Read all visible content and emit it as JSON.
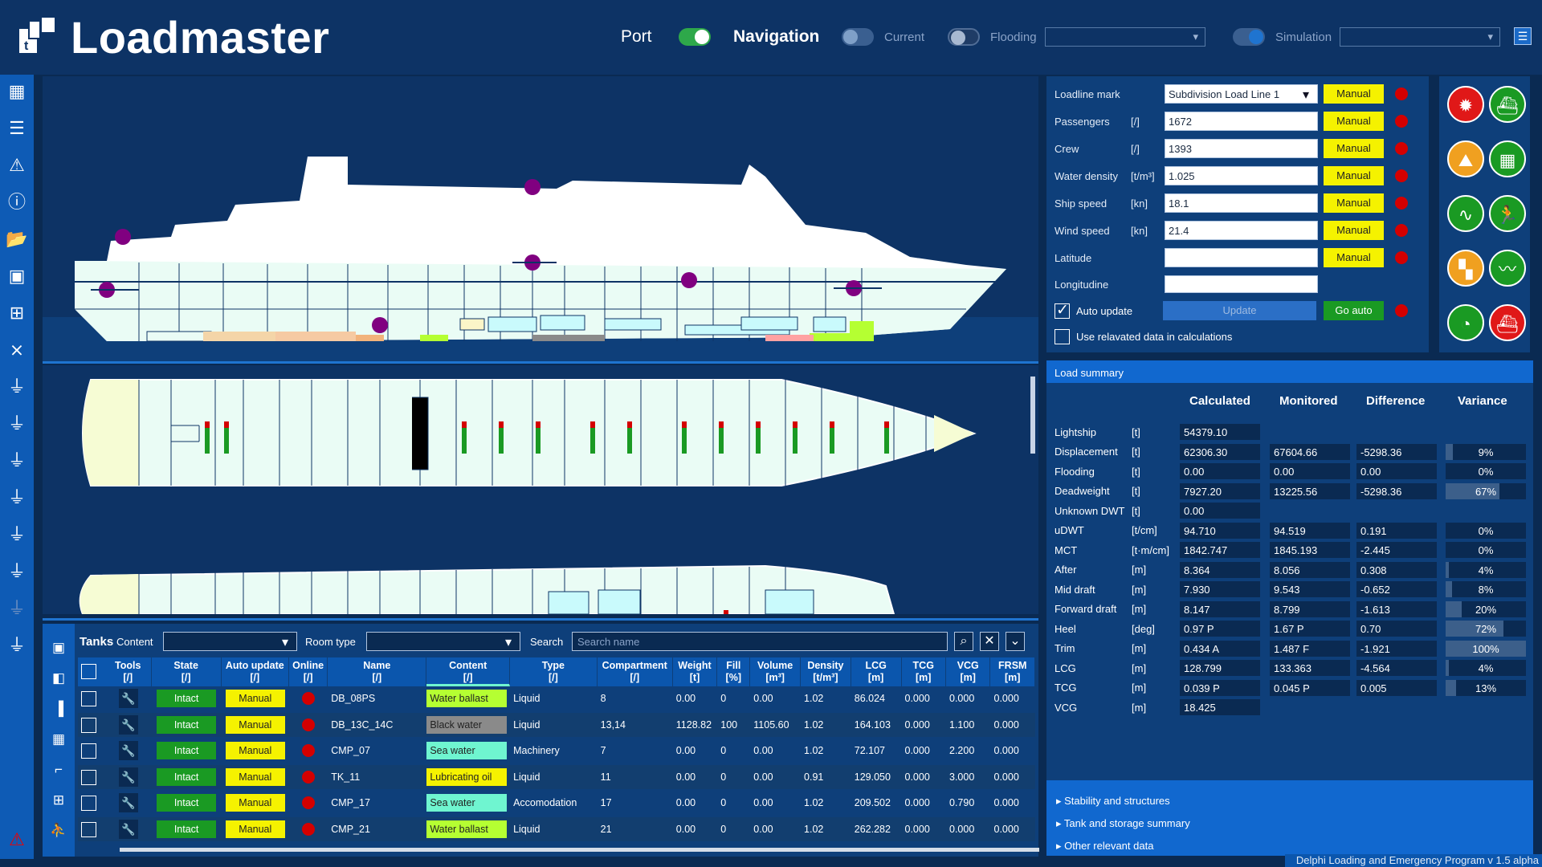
{
  "app": {
    "title": "Loadmaster",
    "version": "Delphi Loading and Emergency Program v 1.5 alpha"
  },
  "modes": {
    "port": "Port",
    "navigation": "Navigation",
    "current": "Current",
    "flooding": "Flooding",
    "simulation": "Simulation"
  },
  "conditions": {
    "loadline_mark": {
      "label": "Loadline mark",
      "unit": "",
      "value": "Subdivision Load Line 1",
      "mode": "Manual"
    },
    "passengers": {
      "label": "Passengers",
      "unit": "[/]",
      "value": "1672",
      "mode": "Manual"
    },
    "crew": {
      "label": "Crew",
      "unit": "[/]",
      "value": "1393",
      "mode": "Manual"
    },
    "water_density": {
      "label": "Water density",
      "unit": "[t/m³]",
      "value": "1.025",
      "mode": "Manual"
    },
    "ship_speed": {
      "label": "Ship speed",
      "unit": "[kn]",
      "value": "18.1",
      "mode": "Manual"
    },
    "wind_speed": {
      "label": "Wind speed",
      "unit": "[kn]",
      "value": "21.4",
      "mode": "Manual"
    },
    "latitude": {
      "label": "Latitude",
      "unit": "",
      "value": "",
      "mode": "Manual"
    },
    "longitude": {
      "label": "Longitudine",
      "unit": "",
      "value": ""
    },
    "auto_update": "Auto update",
    "update_button": "Update",
    "go_auto_button": "Go auto",
    "use_relevant": "Use relavated data in calculations"
  },
  "load_summary": {
    "title": "Load summary",
    "columns": [
      "Calculated",
      "Monitored",
      "Difference",
      "Variance"
    ],
    "rows": [
      {
        "name": "Lightship",
        "unit": "[t]",
        "calc": "54379.10",
        "mon": "",
        "diff": "",
        "var": "",
        "varpct": 0
      },
      {
        "name": "Displacement",
        "unit": "[t]",
        "calc": "62306.30",
        "mon": "67604.66",
        "diff": "-5298.36",
        "var": "9%",
        "varpct": 9
      },
      {
        "name": "Flooding",
        "unit": "[t]",
        "calc": "0.00",
        "mon": "0.00",
        "diff": "0.00",
        "var": "0%",
        "varpct": 0
      },
      {
        "name": "Deadweight",
        "unit": "[t]",
        "calc": "7927.20",
        "mon": "13225.56",
        "diff": "-5298.36",
        "var": "67%",
        "varpct": 67
      },
      {
        "name": "Unknown DWT",
        "unit": "[t]",
        "calc": "0.00",
        "mon": "",
        "diff": "",
        "var": "",
        "varpct": 0
      },
      {
        "name": "uDWT",
        "unit": "[t/cm]",
        "calc": "94.710",
        "mon": "94.519",
        "diff": "0.191",
        "var": "0%",
        "varpct": 0
      },
      {
        "name": "MCT",
        "unit": "[t·m/cm]",
        "calc": "1842.747",
        "mon": "1845.193",
        "diff": "-2.445",
        "var": "0%",
        "varpct": 0
      },
      {
        "name": "After",
        "unit": "[m]",
        "calc": "8.364",
        "mon": "8.056",
        "diff": "0.308",
        "var": "4%",
        "varpct": 4
      },
      {
        "name": "Mid draft",
        "unit": "[m]",
        "calc": "7.930",
        "mon": "9.543",
        "diff": "-0.652",
        "var": "8%",
        "varpct": 8
      },
      {
        "name": "Forward draft",
        "unit": "[m]",
        "calc": "8.147",
        "mon": "8.799",
        "diff": "-1.613",
        "var": "20%",
        "varpct": 20
      },
      {
        "name": "Heel",
        "unit": "[deg]",
        "calc": "0.97 P",
        "mon": "1.67 P",
        "diff": "0.70",
        "var": "72%",
        "varpct": 72
      },
      {
        "name": "Trim",
        "unit": "[m]",
        "calc": "0.434 A",
        "mon": "1.487 F",
        "diff": "-1.921",
        "var": "100%",
        "varpct": 100
      },
      {
        "name": "LCG",
        "unit": "[m]",
        "calc": "128.799",
        "mon": "133.363",
        "diff": "-4.564",
        "var": "4%",
        "varpct": 4
      },
      {
        "name": "TCG",
        "unit": "[m]",
        "calc": "0.039 P",
        "mon": "0.045 P",
        "diff": "0.005",
        "var": "13%",
        "varpct": 13
      },
      {
        "name": "VCG",
        "unit": "[m]",
        "calc": "18.425",
        "mon": "",
        "diff": "",
        "var": "",
        "varpct": 0
      }
    ],
    "links": [
      "Stability and structures",
      "Tank and storage summary",
      "Other relevant data"
    ]
  },
  "tanks": {
    "title": "Tanks",
    "content_label": "Content",
    "roomtype_label": "Room type",
    "search_label": "Search",
    "search_placeholder": "Search name",
    "headers": [
      {
        "top": "Tools",
        "bot": "[/]"
      },
      {
        "top": "State",
        "bot": "[/]"
      },
      {
        "top": "Auto update",
        "bot": "[/]"
      },
      {
        "top": "Online",
        "bot": "[/]"
      },
      {
        "top": "Name",
        "bot": "[/]"
      },
      {
        "top": "Content",
        "bot": "[/]"
      },
      {
        "top": "Type",
        "bot": "[/]"
      },
      {
        "top": "Compartment",
        "bot": "[/]"
      },
      {
        "top": "Weight",
        "bot": "[t]"
      },
      {
        "top": "Fill",
        "bot": "[%]"
      },
      {
        "top": "Volume",
        "bot": "[m³]"
      },
      {
        "top": "Density",
        "bot": "[t/m³]"
      },
      {
        "top": "LCG",
        "bot": "[m]"
      },
      {
        "top": "TCG",
        "bot": "[m]"
      },
      {
        "top": "VCG",
        "bot": "[m]"
      },
      {
        "top": "FRSM",
        "bot": "[m]"
      }
    ],
    "rows": [
      {
        "state": "Intact",
        "auto": "Manual",
        "name": "DB_08PS",
        "content": "Water ballast",
        "ccolor": "#b5ff32",
        "type": "Liquid",
        "comp": "8",
        "weight": "0.00",
        "fill": "0",
        "volume": "0.00",
        "density": "1.02",
        "lcg": "86.024",
        "tcg": "0.000",
        "vcg": "0.000",
        "frsm": "0.000"
      },
      {
        "state": "Intact",
        "auto": "Manual",
        "name": "DB_13C_14C",
        "content": "Black water",
        "ccolor": "#8a8a8a",
        "type": "Liquid",
        "comp": "13,14",
        "weight": "1128.82",
        "fill": "100",
        "volume": "1105.60",
        "density": "1.02",
        "lcg": "164.103",
        "tcg": "0.000",
        "vcg": "1.100",
        "frsm": "0.000"
      },
      {
        "state": "Intact",
        "auto": "Manual",
        "name": "CMP_07",
        "content": "Sea water",
        "ccolor": "#6ff5d0",
        "type": "Machinery",
        "comp": "7",
        "weight": "0.00",
        "fill": "0",
        "volume": "0.00",
        "density": "1.02",
        "lcg": "72.107",
        "tcg": "0.000",
        "vcg": "2.200",
        "frsm": "0.000"
      },
      {
        "state": "Intact",
        "auto": "Manual",
        "name": "TK_11",
        "content": "Lubricating oil",
        "ccolor": "#f5f200",
        "type": "Liquid",
        "comp": "11",
        "weight": "0.00",
        "fill": "0",
        "volume": "0.00",
        "density": "0.91",
        "lcg": "129.050",
        "tcg": "0.000",
        "vcg": "3.000",
        "frsm": "0.000"
      },
      {
        "state": "Intact",
        "auto": "Manual",
        "name": "CMP_17",
        "content": "Sea water",
        "ccolor": "#6ff5d0",
        "type": "Accomodation",
        "comp": "17",
        "weight": "0.00",
        "fill": "0",
        "volume": "0.00",
        "density": "1.02",
        "lcg": "209.502",
        "tcg": "0.000",
        "vcg": "0.790",
        "frsm": "0.000"
      },
      {
        "state": "Intact",
        "auto": "Manual",
        "name": "CMP_21",
        "content": "Water ballast",
        "ccolor": "#b5ff32",
        "type": "Liquid",
        "comp": "21",
        "weight": "0.00",
        "fill": "0",
        "volume": "0.00",
        "density": "1.02",
        "lcg": "262.282",
        "tcg": "0.000",
        "vcg": "0.000",
        "frsm": "0.000"
      }
    ]
  },
  "colors": {
    "accent": "#1168cf",
    "panel": "#0e3f7a",
    "manual": "#f5f200",
    "intact": "#1a9a23",
    "alarm": "#d40000"
  }
}
